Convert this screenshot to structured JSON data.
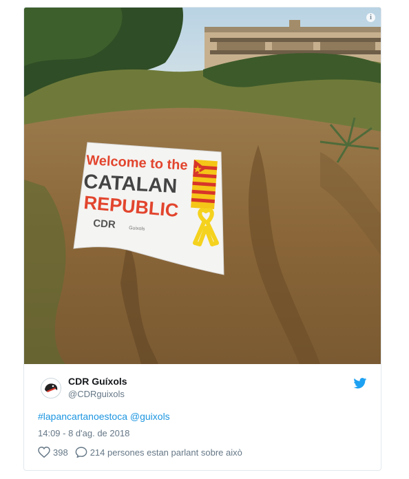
{
  "banner": {
    "line1": "Welcome to the",
    "line2": "CATALAN",
    "line3": "REPUBLIC",
    "org": "CDR",
    "org_sub": "Guixols"
  },
  "media": {
    "info_icon": "info-icon",
    "info_label": "i"
  },
  "tweet": {
    "author_name": "CDR Guíxols",
    "author_handle": "@CDRguixols",
    "hashtag": "#lapancartanoestoca",
    "mention": "@guixols",
    "timestamp": "14:09 - 8 d'ag. de 2018",
    "likes": "398",
    "replies_text": "214 persones estan parlant sobre això"
  },
  "colors": {
    "link": "#1b95e0",
    "muted": "#657786",
    "twitter_blue": "#1da1f2",
    "banner_red": "#e2452e",
    "banner_dark": "#444444",
    "ribbon_yellow": "#f5d21e"
  }
}
